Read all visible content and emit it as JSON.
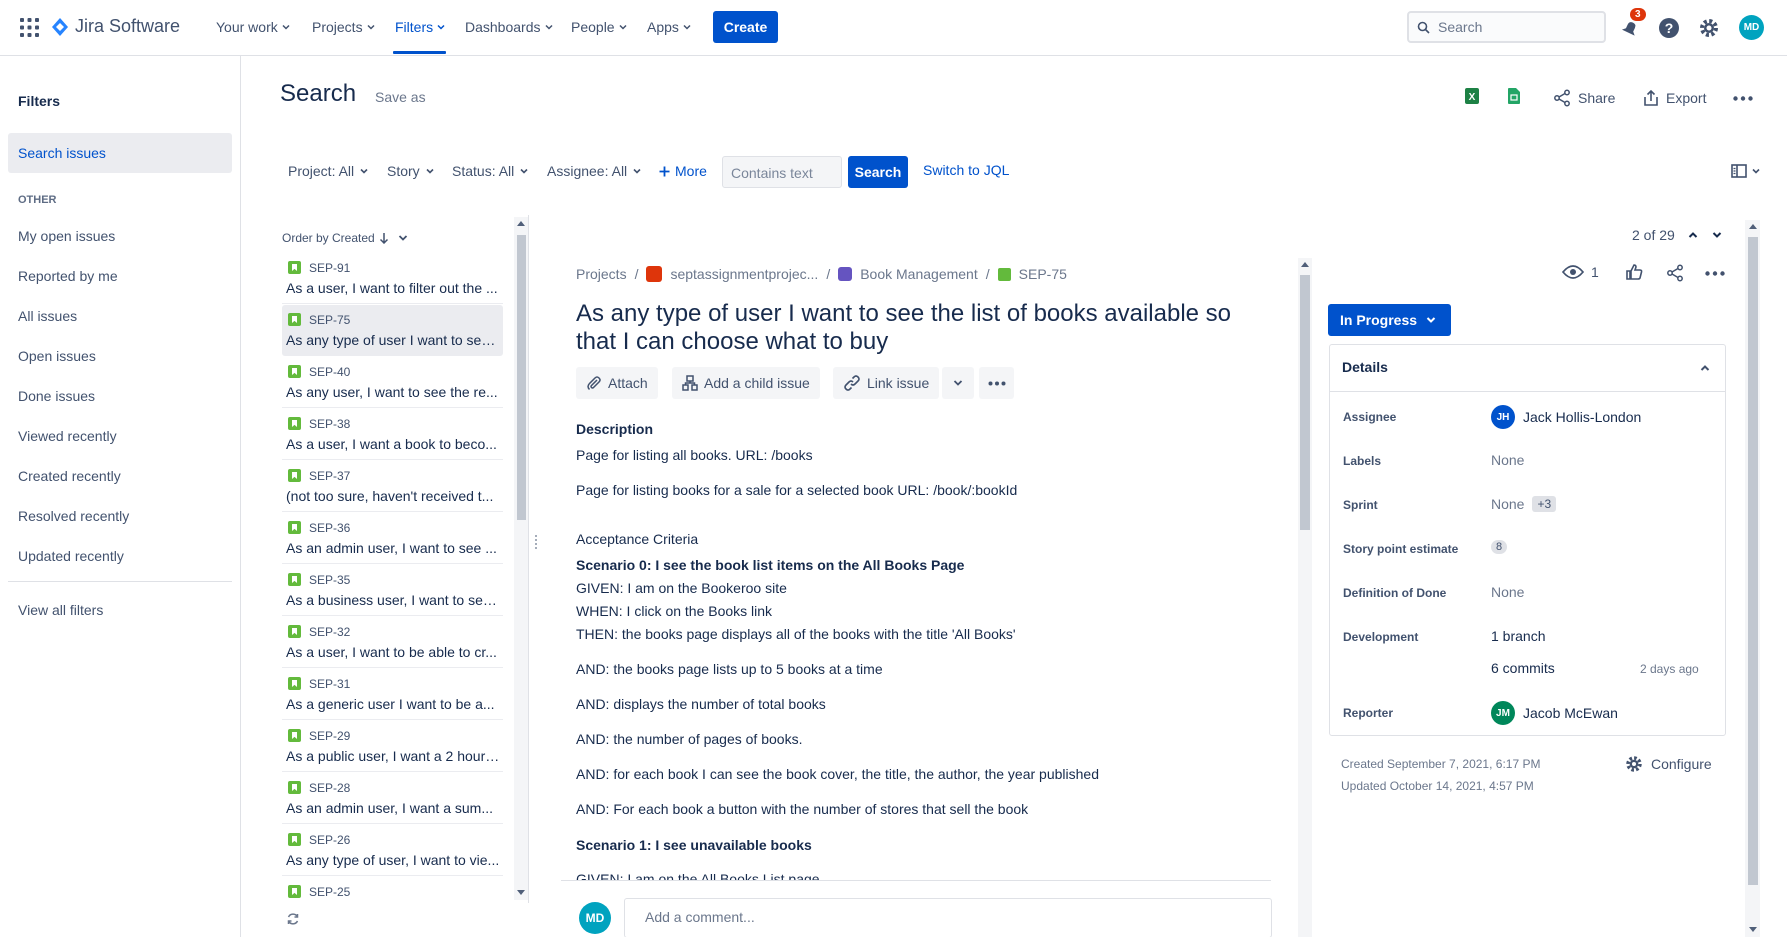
{
  "topnav": {
    "brand": "Jira Software",
    "items": [
      {
        "label": "Your work"
      },
      {
        "label": "Projects"
      },
      {
        "label": "Filters"
      },
      {
        "label": "Dashboards"
      },
      {
        "label": "People"
      },
      {
        "label": "Apps"
      }
    ],
    "create_label": "Create",
    "search_placeholder": "Search",
    "notifications_count": "3",
    "user_initials": "MD"
  },
  "sidebar": {
    "title": "Filters",
    "active_item": "Search issues",
    "other_heading": "OTHER",
    "items": [
      {
        "label": "My open issues"
      },
      {
        "label": "Reported by me"
      },
      {
        "label": "All issues"
      },
      {
        "label": "Open issues"
      },
      {
        "label": "Done issues"
      },
      {
        "label": "Viewed recently"
      },
      {
        "label": "Created recently"
      },
      {
        "label": "Resolved recently"
      },
      {
        "label": "Updated recently"
      }
    ],
    "view_all": "View all filters"
  },
  "header": {
    "title": "Search",
    "save_as": "Save as",
    "share": "Share",
    "export": "Export"
  },
  "filters": {
    "project": "Project: All",
    "type": "Story",
    "status": "Status: All",
    "assignee": "Assignee: All",
    "more": "More",
    "contains_placeholder": "Contains text",
    "search_button": "Search",
    "switch_jql": "Switch to JQL"
  },
  "issue_list": {
    "order_by": "Order by Created",
    "items": [
      {
        "key": "SEP-91",
        "summary": "As a user, I want to filter out the ..."
      },
      {
        "key": "SEP-75",
        "summary": "As any type of user I want to see..."
      },
      {
        "key": "SEP-40",
        "summary": "As any user, I want to see the re..."
      },
      {
        "key": "SEP-38",
        "summary": "As a user, I want a book to beco..."
      },
      {
        "key": "SEP-37",
        "summary": "(not too sure, haven't received t..."
      },
      {
        "key": "SEP-36",
        "summary": "As an admin user, I want to see ..."
      },
      {
        "key": "SEP-35",
        "summary": "As a business user, I want to see ..."
      },
      {
        "key": "SEP-32",
        "summary": "As a user, I want to be able to cr..."
      },
      {
        "key": "SEP-31",
        "summary": "As a generic user I want to be a..."
      },
      {
        "key": "SEP-29",
        "summary": "As a public user, I want a 2 hour ..."
      },
      {
        "key": "SEP-28",
        "summary": "As an admin user, I want a sum..."
      },
      {
        "key": "SEP-26",
        "summary": "As any type of user, I want to vie..."
      },
      {
        "key": "SEP-25",
        "summary": ""
      }
    ]
  },
  "issue": {
    "pager": "2 of 29",
    "crumbs": {
      "projects": "Projects",
      "project": "septassignmentprojec...",
      "epic": "Book Management",
      "key": "SEP-75"
    },
    "watchers": "1",
    "title": "As any type of user I want to see the list of books available so that I can choose what to buy",
    "actions": {
      "attach": "Attach",
      "child": "Add a child issue",
      "link": "Link issue"
    },
    "description_heading": "Description",
    "description": [
      "Page for listing all books. URL: /books",
      "Page for listing books for a sale for a selected book URL: /book/:bookId"
    ],
    "acceptance_heading": "Acceptance Criteria",
    "scenario0": "Scenario 0: I see the book list items on the All Books Page",
    "lines": [
      "GIVEN: I am on the Bookeroo site",
      "WHEN: I click on the Books link",
      "THEN: the books page displays all of the books with the title 'All Books'",
      "AND: the books page lists up to 5 books at a time",
      "AND: displays the number of total books",
      "AND: the number of pages of books.",
      "AND: for each book I can see the book cover, the title, the author, the year published",
      "AND: For each book a button with the number of stores that sell the book"
    ],
    "scenario1": "Scenario 1: I see unavailable books",
    "cut_line": "GIVEN: I am on the All Books List page",
    "comment_placeholder": "Add a comment..."
  },
  "details": {
    "status": "In Progress",
    "heading": "Details",
    "assignee_label": "Assignee",
    "assignee": "Jack Hollis-London",
    "assignee_initials": "JH",
    "labels_label": "Labels",
    "labels": "None",
    "sprint_label": "Sprint",
    "sprint": "None",
    "sprint_extra": "+3",
    "sp_label": "Story point estimate",
    "sp": "8",
    "dod_label": "Definition of Done",
    "dod": "None",
    "dev_label": "Development",
    "branch": "1 branch",
    "commits": "6 commits",
    "commits_time": "2 days ago",
    "reporter_label": "Reporter",
    "reporter": "Jacob McEwan",
    "reporter_initials": "JM",
    "created": "Created September 7, 2021, 6:17 PM",
    "updated": "Updated October 14, 2021, 4:57 PM",
    "configure": "Configure"
  },
  "colors": {
    "accent": "#0052cc",
    "story": "#63ba3c",
    "user_avatar": "#00a3bf",
    "jh_avatar": "#0052cc",
    "jm_avatar": "#00875a",
    "notif": "#de350b"
  }
}
